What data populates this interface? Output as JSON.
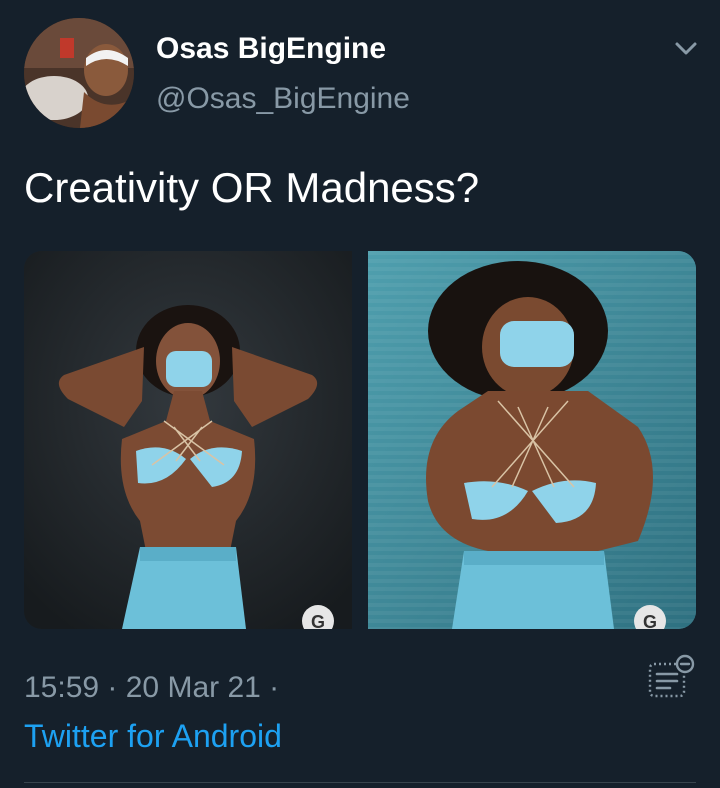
{
  "tweet": {
    "author": {
      "display_name": "Osas BigEngine",
      "handle": "@Osas_BigEngine",
      "avatar_icon": "profile-photo"
    },
    "text": "Creativity OR Madness?",
    "media": [
      {
        "name": "photo-1",
        "watermark": "G"
      },
      {
        "name": "photo-2",
        "watermark": "G"
      }
    ],
    "time": "15:59",
    "date": "20 Mar 21",
    "source": "Twitter for Android",
    "colors": {
      "background": "#15202b",
      "primary_text": "#ffffff",
      "secondary_text": "#8899a6",
      "link": "#1da1f2",
      "divider": "#38444d"
    }
  }
}
